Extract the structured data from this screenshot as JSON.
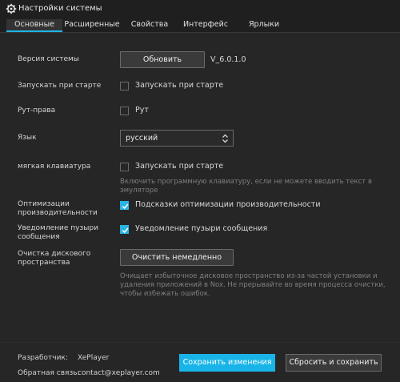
{
  "window": {
    "title": "Настройки системы",
    "icon": "gear-icon"
  },
  "tabs": [
    {
      "label": "Основные",
      "active": true
    },
    {
      "label": "Расширенные",
      "active": false
    },
    {
      "label": "Свойства",
      "active": false
    },
    {
      "label": "Интерфейс",
      "active": false
    },
    {
      "label": "Ярлыки",
      "active": false
    }
  ],
  "settings": {
    "version": {
      "label": "Версия системы",
      "button": "Обновить",
      "value": "V_6.0.1.0"
    },
    "autostart": {
      "label": "Запускать при старте",
      "checkbox_label": "Запускать при старте",
      "checked": false
    },
    "root": {
      "label": "Рут-права",
      "checkbox_label": "Рут",
      "checked": false
    },
    "language": {
      "label": "Язык",
      "selected": "русский"
    },
    "soft_keyboard": {
      "label": "мягкая клавиатура",
      "checkbox_label": "Запускать при старте",
      "checked": false,
      "hint_line1": "Включить программную клавиатуру, если не можете вводить текст в",
      "hint_line2": "эмуляторе"
    },
    "performance": {
      "label_line1": "Оптимизации",
      "label_line2": "производительности",
      "checkbox_label": "Подсказки оптимизации производительности",
      "checked": true
    },
    "bubbles": {
      "label_line1": "Уведомление пузыри",
      "label_line2": "сообщения",
      "checkbox_label": "Уведомление пузыри сообщения",
      "checked": true
    },
    "disk_cleanup": {
      "label_line1": "Очистка дискового",
      "label_line2": "пространства",
      "button": "Очистить немедленно",
      "hint_line1": "Очищает избыточное дисковое пространство из-за частой установки и",
      "hint_line2": "удаления приложений в Nox. Не прерывайте во время процесса очистки,",
      "hint_line3": "чтобы избежать ошибок."
    }
  },
  "footer": {
    "developer_label": "Разработчик:",
    "developer_value": "XePlayer",
    "feedback_label": "Обратная связь:",
    "feedback_value": "contact@xeplayer.com",
    "save_button": "Сохранить изменения",
    "reset_button": "Сбросить и сохранить"
  },
  "colors": {
    "accent": "#18b4e8",
    "background": "#262626",
    "titlebar": "#1f1f1f"
  }
}
